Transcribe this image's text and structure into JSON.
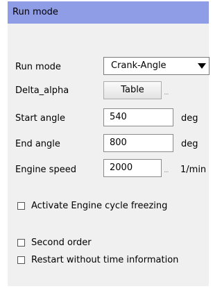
{
  "panel": {
    "title": "Run mode"
  },
  "fields": {
    "run_mode": {
      "label": "Run mode",
      "value": "Crank-Angle"
    },
    "delta_alpha": {
      "label": "Delta_alpha",
      "button_label": "Table",
      "more": "..."
    },
    "start_angle": {
      "label": "Start angle",
      "value": "540",
      "unit": "deg"
    },
    "end_angle": {
      "label": "End angle",
      "value": "800",
      "unit": "deg"
    },
    "engine_speed": {
      "label": "Engine speed",
      "value": "2000",
      "more": "...",
      "unit": "1/min"
    }
  },
  "options": [
    {
      "label": "Activate Engine cycle freezing",
      "checked": false
    },
    {
      "label": "Second order",
      "checked": false
    },
    {
      "label": "Restart without time information",
      "checked": false
    }
  ],
  "icons": {
    "dropdown": "chevron-down-icon"
  }
}
